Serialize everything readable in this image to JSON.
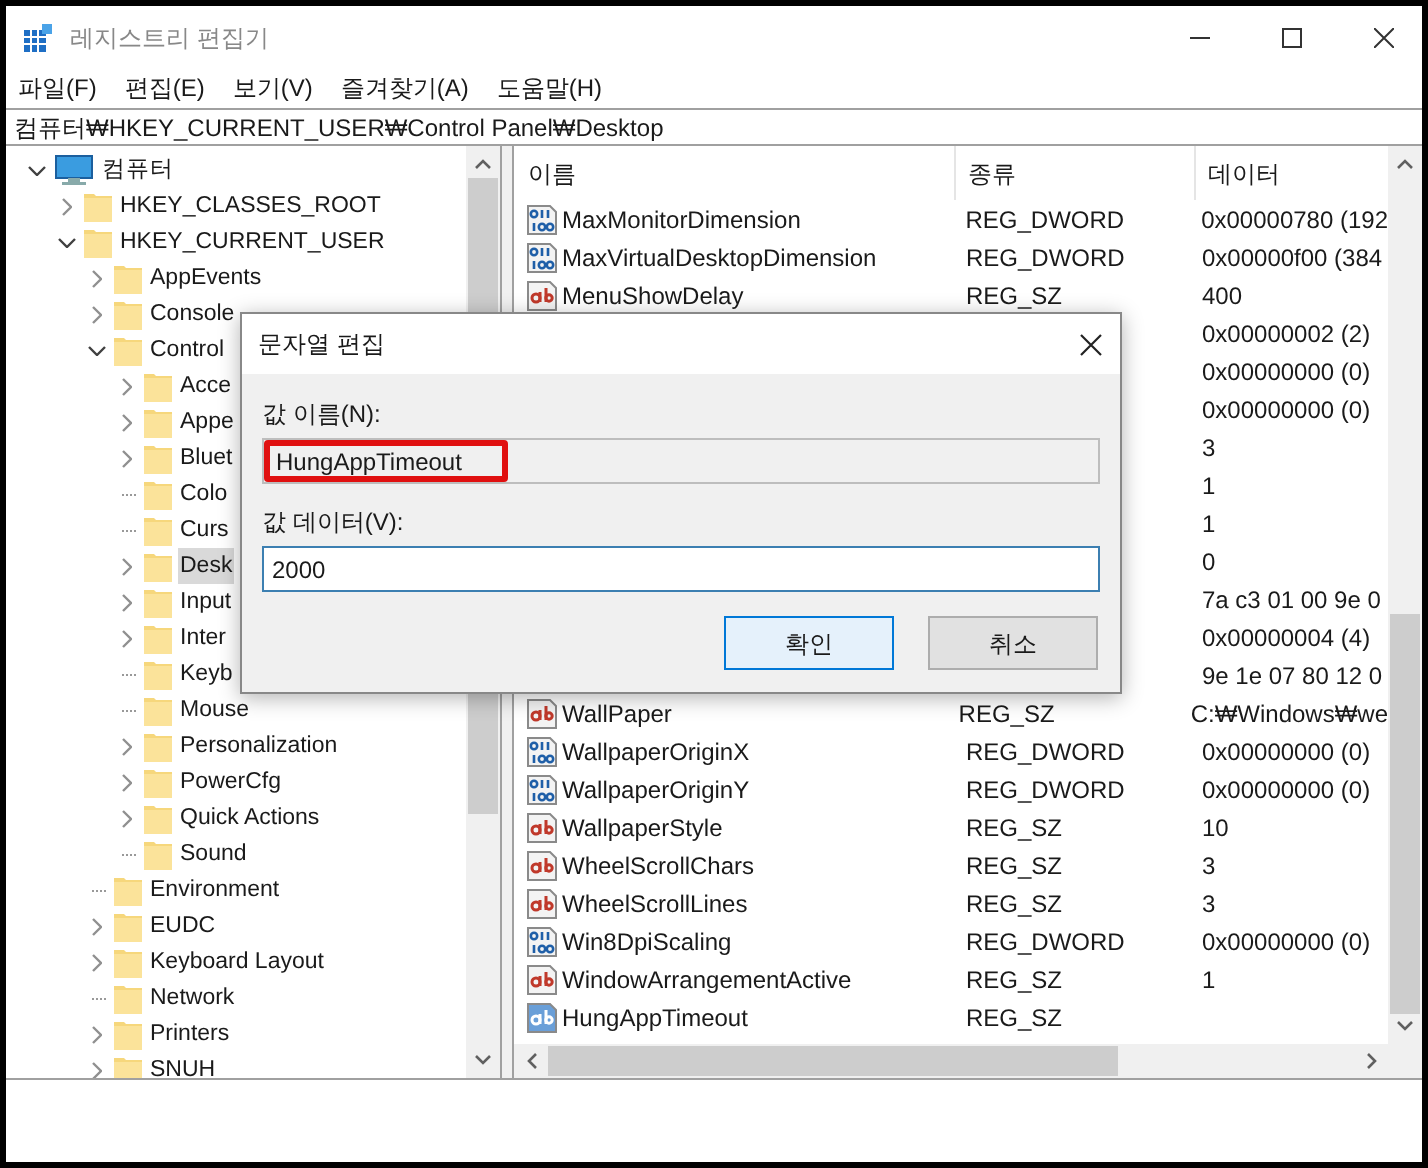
{
  "window": {
    "title": "레지스트리 편집기"
  },
  "menu": [
    "파일(F)",
    "편집(E)",
    "보기(V)",
    "즐겨찾기(A)",
    "도움말(H)"
  ],
  "address": "컴퓨터₩HKEY_CURRENT_USER₩Control Panel₩Desktop",
  "tree": [
    {
      "label": "컴퓨터",
      "kind": "computer",
      "expanded": true,
      "leaf": false,
      "selected": false,
      "children": [
        {
          "label": "HKEY_CLASSES_ROOT",
          "kind": "folder",
          "expanded": false,
          "leaf": false,
          "selected": false
        },
        {
          "label": "HKEY_CURRENT_USER",
          "kind": "folder",
          "expanded": true,
          "leaf": false,
          "selected": false,
          "children": [
            {
              "label": "AppEvents",
              "kind": "folder",
              "expanded": false,
              "leaf": false,
              "selected": false
            },
            {
              "label": "Console",
              "kind": "folder",
              "expanded": false,
              "leaf": false,
              "selected": false
            },
            {
              "label": "Control",
              "kind": "folder",
              "expanded": true,
              "leaf": false,
              "selected": false,
              "children": [
                {
                  "label": "Acce",
                  "kind": "folder",
                  "expanded": false,
                  "leaf": false,
                  "selected": false
                },
                {
                  "label": "Appe",
                  "kind": "folder",
                  "expanded": false,
                  "leaf": false,
                  "selected": false
                },
                {
                  "label": "Bluet",
                  "kind": "folder",
                  "expanded": false,
                  "leaf": false,
                  "selected": false
                },
                {
                  "label": "Colo",
                  "kind": "folder",
                  "expanded": false,
                  "leaf": true,
                  "selected": false
                },
                {
                  "label": "Curs",
                  "kind": "folder",
                  "expanded": false,
                  "leaf": true,
                  "selected": false
                },
                {
                  "label": "Desk",
                  "kind": "folder",
                  "expanded": false,
                  "leaf": false,
                  "selected": true
                },
                {
                  "label": "Input",
                  "kind": "folder",
                  "expanded": false,
                  "leaf": false,
                  "selected": false
                },
                {
                  "label": "Inter",
                  "kind": "folder",
                  "expanded": false,
                  "leaf": false,
                  "selected": false
                },
                {
                  "label": "Keyb",
                  "kind": "folder",
                  "expanded": false,
                  "leaf": true,
                  "selected": false
                },
                {
                  "label": "Mouse",
                  "kind": "folder",
                  "expanded": false,
                  "leaf": true,
                  "selected": false
                },
                {
                  "label": "Personalization",
                  "kind": "folder",
                  "expanded": false,
                  "leaf": false,
                  "selected": false
                },
                {
                  "label": "PowerCfg",
                  "kind": "folder",
                  "expanded": false,
                  "leaf": false,
                  "selected": false
                },
                {
                  "label": "Quick Actions",
                  "kind": "folder",
                  "expanded": false,
                  "leaf": false,
                  "selected": false
                },
                {
                  "label": "Sound",
                  "kind": "folder",
                  "expanded": false,
                  "leaf": true,
                  "selected": false
                }
              ]
            },
            {
              "label": "Environment",
              "kind": "folder",
              "expanded": false,
              "leaf": true,
              "selected": false
            },
            {
              "label": "EUDC",
              "kind": "folder",
              "expanded": false,
              "leaf": false,
              "selected": false
            },
            {
              "label": "Keyboard Layout",
              "kind": "folder",
              "expanded": false,
              "leaf": false,
              "selected": false
            },
            {
              "label": "Network",
              "kind": "folder",
              "expanded": false,
              "leaf": true,
              "selected": false
            },
            {
              "label": "Printers",
              "kind": "folder",
              "expanded": false,
              "leaf": false,
              "selected": false
            },
            {
              "label": "SNUH",
              "kind": "folder",
              "expanded": false,
              "leaf": false,
              "selected": false
            }
          ]
        }
      ]
    }
  ],
  "table": {
    "columns": [
      "이름",
      "종류",
      "데이터"
    ],
    "rows": [
      {
        "kind": "dword",
        "name": "MaxMonitorDimension",
        "type": "REG_DWORD",
        "data": "0x00000780 (192",
        "selected": false
      },
      {
        "kind": "dword",
        "name": "MaxVirtualDesktopDimension",
        "type": "REG_DWORD",
        "data": "0x00000f00 (384",
        "selected": false
      },
      {
        "kind": "sz",
        "name": "MenuShowDelay",
        "type": "REG_SZ",
        "data": "400",
        "selected": false
      },
      {
        "data": "0x00000002 (2)"
      },
      {
        "data": "0x00000000 (0)"
      },
      {
        "data": "0x00000000 (0)"
      },
      {
        "data": "3"
      },
      {
        "data": "1"
      },
      {
        "data": "1"
      },
      {
        "data": "0"
      },
      {
        "data": "7a c3 01 00 9e 0"
      },
      {
        "data": "0x00000004 (4)"
      },
      {
        "data": "9e 1e 07 80 12 0"
      },
      {
        "kind": "sz",
        "name": "WallPaper",
        "type": "REG_SZ",
        "data": "C:₩Windows₩we",
        "selected": false
      },
      {
        "kind": "dword",
        "name": "WallpaperOriginX",
        "type": "REG_DWORD",
        "data": "0x00000000 (0)",
        "selected": false
      },
      {
        "kind": "dword",
        "name": "WallpaperOriginY",
        "type": "REG_DWORD",
        "data": "0x00000000 (0)",
        "selected": false
      },
      {
        "kind": "sz",
        "name": "WallpaperStyle",
        "type": "REG_SZ",
        "data": "10",
        "selected": false
      },
      {
        "kind": "sz",
        "name": "WheelScrollChars",
        "type": "REG_SZ",
        "data": "3",
        "selected": false
      },
      {
        "kind": "sz",
        "name": "WheelScrollLines",
        "type": "REG_SZ",
        "data": "3",
        "selected": false
      },
      {
        "kind": "dword",
        "name": "Win8DpiScaling",
        "type": "REG_DWORD",
        "data": "0x00000000 (0)",
        "selected": false
      },
      {
        "kind": "sz",
        "name": "WindowArrangementActive",
        "type": "REG_SZ",
        "data": "1",
        "selected": false
      },
      {
        "kind": "sz",
        "name": "HungAppTimeout",
        "type": "REG_SZ",
        "selected": true
      }
    ]
  },
  "dialog": {
    "title": "문자열 편집",
    "name_label": "값 이름(N):",
    "name_value": "HungAppTimeout",
    "name_highlighted": true,
    "data_label": "값 데이터(V):",
    "data_value": "2000",
    "buttons": [
      {
        "label": "확인",
        "default": true
      },
      {
        "label": "취소",
        "default": false
      }
    ]
  }
}
